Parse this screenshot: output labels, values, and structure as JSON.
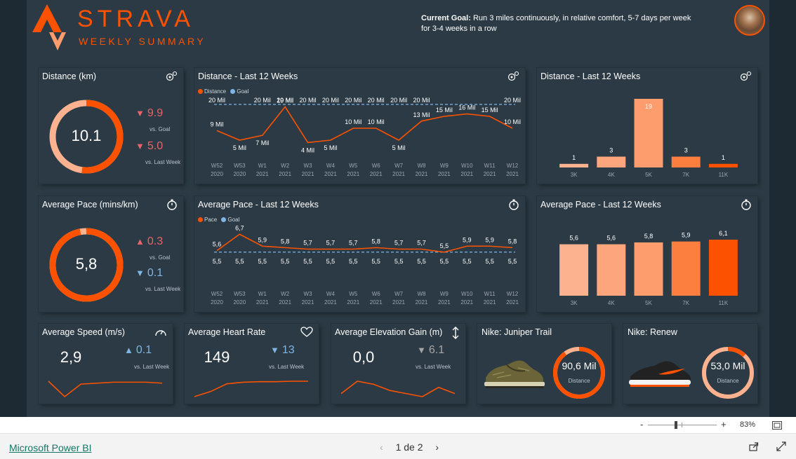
{
  "header": {
    "title": "STRAVA",
    "subtitle": "WEEKLY SUMMARY",
    "goal_label": "Current Goal:",
    "goal_text": " Run 3 miles continuously, in relative comfort, 5-7 days per week for 3-4 weeks in a row"
  },
  "colors": {
    "brand": "#fc5200",
    "accent_light": "#fda67e",
    "goal_line": "#7fb6e6",
    "down_red": "#e8646b",
    "up_blue": "#7fb6e6",
    "neutral": "#a7a7a7"
  },
  "distance_kpi": {
    "title": "Distance (km)",
    "icon": "map-pin-icon",
    "value": "10.1",
    "progress": 0.52,
    "vs_goal_value": "9.9",
    "vs_goal_dir": "down",
    "vs_goal_label": "vs. Goal",
    "vs_last_value": "5.0",
    "vs_last_dir": "down",
    "vs_last_label": "vs. Last Week"
  },
  "pace_kpi": {
    "title": "Average Pace (mins/km)",
    "icon": "stopwatch-icon",
    "value": "5,8",
    "progress": 0.97,
    "vs_goal_value": "0.3",
    "vs_goal_dir": "up",
    "vs_goal_label": "vs. Goal",
    "vs_last_value": "0.1",
    "vs_last_dir": "down",
    "vs_last_label": "vs. Last Week"
  },
  "distance_trend": {
    "title": "Distance - Last 12 Weeks",
    "legend": [
      "Distance",
      "Goal"
    ],
    "weeks": [
      "W52",
      "W53",
      "W1",
      "W2",
      "W3",
      "W4",
      "W5",
      "W6",
      "W7",
      "W8",
      "W9",
      "W10",
      "W11",
      "W12"
    ],
    "years": [
      "2020",
      "2020",
      "2021",
      "2021",
      "2021",
      "2021",
      "2021",
      "2021",
      "2021",
      "2021",
      "2021",
      "2021",
      "2021",
      "2021"
    ],
    "distance_labels": [
      "9 Mil",
      "5 Mil",
      "7 Mil",
      "19 Mil",
      "4 Mil",
      "5 Mil",
      "10 Mil",
      "10 Mil",
      "5 Mil",
      "13 Mil",
      "15 Mil",
      "16 Mil",
      "15 Mil",
      "10 Mil"
    ],
    "goal_labels": [
      "20 Mil",
      "",
      "20 Mil",
      "20 Mil",
      "20 Mil",
      "20 Mil",
      "20 Mil",
      "20 Mil",
      "20 Mil",
      "20 Mil",
      "",
      "",
      "",
      "20 Mil"
    ],
    "distance_values": [
      9,
      5,
      7,
      19,
      4,
      5,
      10,
      10,
      5,
      13,
      15,
      16,
      15,
      10
    ],
    "goal_value": 20
  },
  "distance_buckets": {
    "title": "Distance - Last 12 Weeks",
    "categories": [
      "3K",
      "4K",
      "5K",
      "7K",
      "11K"
    ],
    "values": [
      1,
      3,
      19,
      3,
      1
    ],
    "colors": [
      "#fdb28f",
      "#fda67e",
      "#fd9c6c",
      "#fd7f3f",
      "#fc5200"
    ]
  },
  "pace_trend": {
    "title": "Average Pace - Last 12 Weeks",
    "legend": [
      "Pace",
      "Goal"
    ],
    "weeks": [
      "W52",
      "W53",
      "W1",
      "W2",
      "W3",
      "W4",
      "W5",
      "W6",
      "W7",
      "W8",
      "W9",
      "W10",
      "W11",
      "W12"
    ],
    "years": [
      "2020",
      "2020",
      "2021",
      "2021",
      "2021",
      "2021",
      "2021",
      "2021",
      "2021",
      "2021",
      "2021",
      "2021",
      "2021",
      "2021"
    ],
    "pace_labels": [
      "5,6",
      "6,7",
      "5,9",
      "5,8",
      "5,7",
      "5,7",
      "5,7",
      "5,8",
      "5,7",
      "5,7",
      "5,5",
      "5,9",
      "5,9",
      "5,8"
    ],
    "goal_labels": [
      "5,5",
      "5,5",
      "5,5",
      "5,5",
      "5,5",
      "5,5",
      "5,5",
      "5,5",
      "5,5",
      "5,5",
      "5,5",
      "5,5",
      "5,5",
      "5,5"
    ],
    "pace_values": [
      5.6,
      6.7,
      5.9,
      5.8,
      5.7,
      5.7,
      5.7,
      5.8,
      5.7,
      5.7,
      5.5,
      5.9,
      5.9,
      5.8
    ],
    "goal_value": 5.5
  },
  "pace_buckets": {
    "title": "Average Pace - Last 12 Weeks",
    "categories": [
      "3K",
      "4K",
      "5K",
      "7K",
      "11K"
    ],
    "values": [
      5.6,
      5.6,
      5.8,
      5.9,
      6.1
    ],
    "labels": [
      "5,6",
      "5,6",
      "5,8",
      "5,9",
      "6,1"
    ],
    "colors": [
      "#fdb28f",
      "#fda67e",
      "#fd9c6c",
      "#fd7f3f",
      "#fc5200"
    ]
  },
  "speed_kpi": {
    "title": "Average Speed (m/s)",
    "icon": "speedometer-icon",
    "value": "2,9",
    "delta": "0.1",
    "delta_dir": "up",
    "delta_label": "vs. Last Week",
    "spark": [
      3.0,
      2.2,
      2.85,
      2.9,
      2.95,
      2.95,
      2.95,
      2.9
    ]
  },
  "heart_kpi": {
    "title": "Average Heart Rate",
    "icon": "heart-icon",
    "value": "149",
    "delta": "13",
    "delta_dir": "down",
    "delta_label": "vs. Last Week",
    "spark": [
      120,
      130,
      145,
      148,
      149,
      149,
      150,
      150
    ]
  },
  "elev_kpi": {
    "title": "Average Elevation Gain (m)",
    "icon": "elevation-icon",
    "value": "0,0",
    "delta": "6.1",
    "delta_dir": "flat",
    "delta_label": "vs. Last Week",
    "spark": [
      2,
      6,
      5,
      3,
      2,
      1,
      4,
      2
    ]
  },
  "shoe1": {
    "title": "Nike: Juniper Trail",
    "value": "90,6 Mil",
    "label": "Distance",
    "progress": 0.9
  },
  "shoe2": {
    "title": "Nike: Renew",
    "value": "53,0 Mil",
    "label": "Distance",
    "progress": 0.12
  },
  "statusbar": {
    "zoom": "83%",
    "minus": "-",
    "plus": "+"
  },
  "footer": {
    "link": "Microsoft Power BI",
    "page": "1 de 2"
  }
}
